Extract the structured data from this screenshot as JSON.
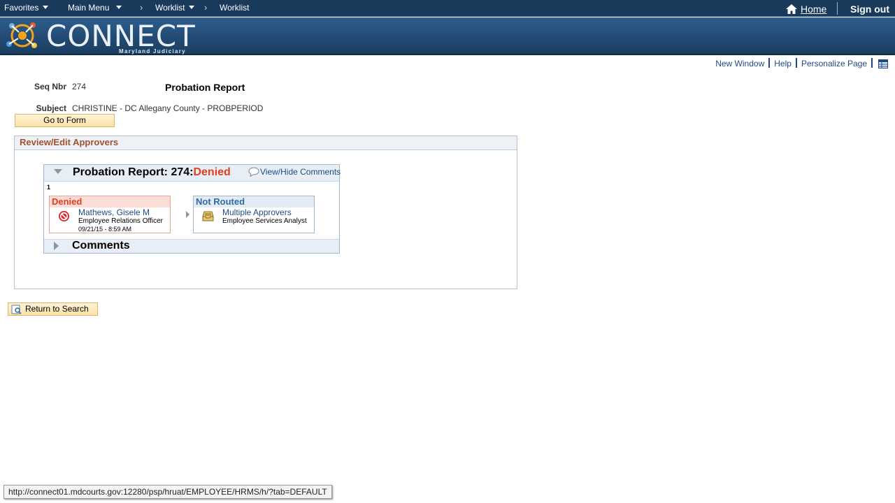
{
  "topnav": {
    "favorites": "Favorites",
    "main_menu": "Main Menu",
    "crumbs": [
      "Worklist",
      "Worklist"
    ],
    "home": "Home",
    "sign_out": "Sign out"
  },
  "banner": {
    "logo_text": "CONNECT",
    "logo_subtitle": "Maryland Judiciary"
  },
  "page_links": {
    "new_window": "New Window",
    "help": "Help",
    "personalize": "Personalize Page"
  },
  "header": {
    "seq_label": "Seq Nbr",
    "seq_value": "274",
    "title": "Probation Report",
    "subject_label": "Subject",
    "subject_value": "CHRISTINE - DC Allegany County - PROBPERIOD",
    "go_to_form": "Go to Form"
  },
  "review": {
    "section_title": "Review/Edit Approvers",
    "approval_title": "Probation Report: 274:",
    "approval_status": "Denied",
    "view_hide_comments": "View/Hide Comments",
    "step_number": "1",
    "steps": [
      {
        "status": "Denied",
        "name": "Mathews, Gisele M",
        "role": "Employee Relations Officer",
        "date": "09/21/15 - 8:59 AM"
      },
      {
        "status": "Not Routed",
        "name": "Multiple Approvers",
        "role": "Employee Services Analyst"
      }
    ],
    "comments_label": "Comments"
  },
  "return_to_search": "Return to Search",
  "status_url": "http://connect01.mdcourts.gov:12280/psp/hruat/EMPLOYEE/HRMS/h/?tab=DEFAULT",
  "colors": {
    "denied": "#e0401d",
    "link": "#1f4a86",
    "section_title": "#a0522d",
    "topbar": "#1a3a5c"
  }
}
